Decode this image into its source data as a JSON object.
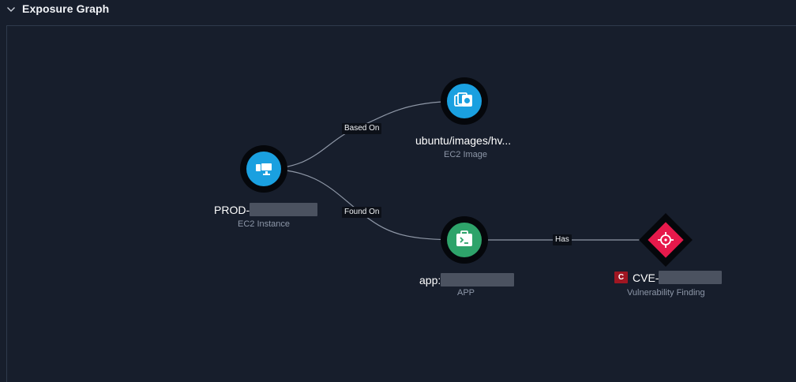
{
  "header": {
    "title": "Exposure Graph"
  },
  "nodes": {
    "instance": {
      "title_prefix": "PROD-",
      "subtitle": "EC2 Instance",
      "color": "#1aa0e0"
    },
    "image": {
      "title": "ubuntu/images/hv...",
      "subtitle": "EC2 Image",
      "color": "#1aa0e0"
    },
    "app": {
      "title_prefix": "app:",
      "subtitle": "APP",
      "color": "#2ea36a"
    },
    "vuln": {
      "severity": "C",
      "title_prefix": "CVE-",
      "subtitle": "Vulnerability Finding",
      "color": "#e6194b"
    }
  },
  "edges": {
    "based_on": "Based On",
    "found_on": "Found On",
    "has": "Has"
  }
}
